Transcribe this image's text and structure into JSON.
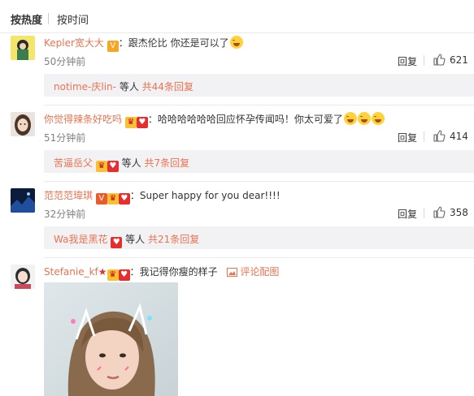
{
  "sort": {
    "hot_label": "按热度",
    "time_label": "按时间"
  },
  "comments": [
    {
      "user": "Kepler宽大大",
      "colon": "：",
      "text": "跟杰伦比 你还是可以了",
      "time": "50分钟前",
      "reply_label": "回复",
      "likes": "621",
      "sub": {
        "user": "notime-庆lin-",
        "suffix": "等人",
        "count_link": "共44条回复"
      }
    },
    {
      "user": "你觉得辣条好吃吗",
      "colon": "：",
      "text": "哈哈哈哈哈哈回应怀孕传闻吗！你太可爱了",
      "time": "51分钟前",
      "reply_label": "回复",
      "likes": "414",
      "sub": {
        "user": "苦逼岳父",
        "suffix": "等人",
        "count_link": "共7条回复"
      }
    },
    {
      "user": "范范范瑋琪",
      "colon": "：",
      "text": "Super happy for you dear!!!!",
      "time": "32分钟前",
      "reply_label": "回复",
      "likes": "358",
      "sub": {
        "user": "Wa我是黑花",
        "suffix": "等人",
        "count_link": "共21条回复"
      }
    },
    {
      "user": "Stefanie_kf",
      "colon": "：",
      "text": "我记得你瘦的样子",
      "pic_link": "评论配图"
    }
  ],
  "colors": {
    "accent": "#eb7350",
    "subbox_bg": "#f2f2f5",
    "time": "#808080"
  },
  "icons": [
    "thumbs-up-icon",
    "laughing-emoji-icon",
    "vip-badge-icon",
    "verified-v-icon",
    "picture-icon"
  ]
}
